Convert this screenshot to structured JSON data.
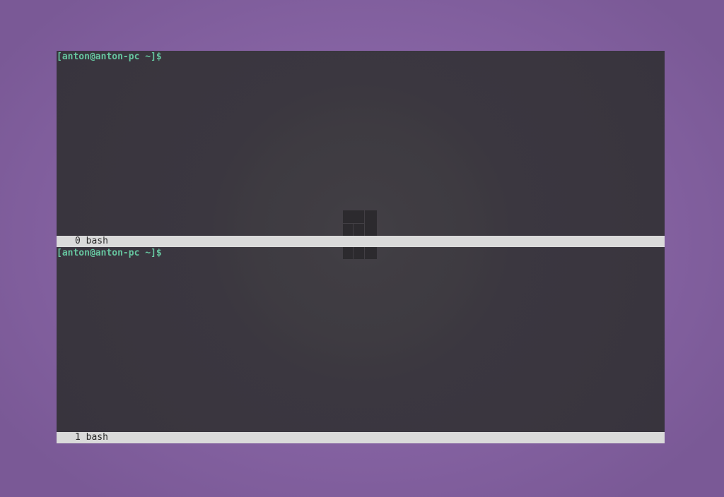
{
  "desktop": {
    "background_color": "#8663a3"
  },
  "terminal": {
    "background_color": "#3a363f",
    "prompt_color": "#66c59f",
    "status_bar_color": "#dadada",
    "watermark_icon": "manjaro-logo-icon",
    "panes": [
      {
        "prompt": "[anton@anton-pc ~]$",
        "status": "0 bash"
      },
      {
        "prompt": "[anton@anton-pc ~]$",
        "status": "1 bash"
      }
    ]
  }
}
